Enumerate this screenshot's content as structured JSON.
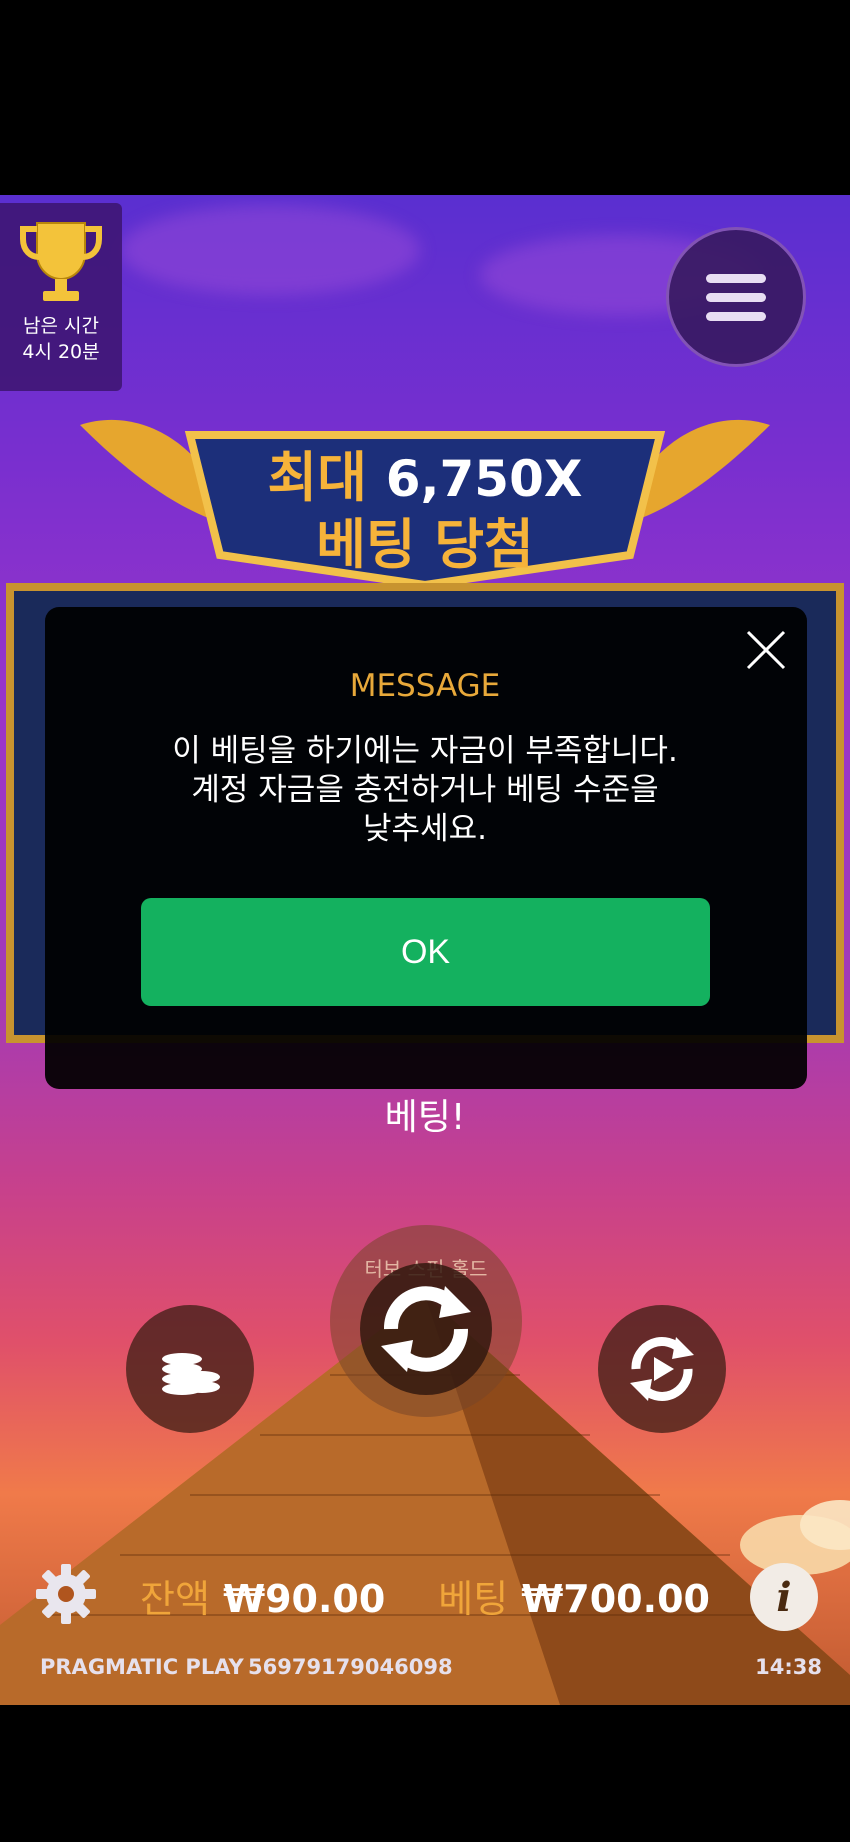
{
  "tournament": {
    "remaining_label": "남은 시간",
    "remaining_value": "4시 20분"
  },
  "banner": {
    "line1_prefix": "최대",
    "line1_value": "6,750X",
    "line2": "베팅 당첨"
  },
  "dialog": {
    "title": "MESSAGE",
    "body_lines": [
      "이 베팅을 하기에는 자금이 부족합니다.",
      "계정 자금을 충전하거나 베팅 수준을",
      "낮추세요."
    ],
    "ok_label": "OK"
  },
  "bet_prompt": "베팅!",
  "spin": {
    "turbo_hint": "터보 스핀 홀드"
  },
  "status": {
    "balance_label": "잔액",
    "balance_value": "₩90.00",
    "bet_label": "베팅",
    "bet_value": "₩700.00"
  },
  "footer": {
    "brand": "PRAGMATIC PLAY",
    "session_id": "56979179046098",
    "time": "14:38"
  },
  "icons": [
    "trophy-icon",
    "menu-icon",
    "close-icon",
    "coins-icon",
    "spin-icon",
    "autoplay-icon",
    "settings-icon",
    "info-icon"
  ],
  "colors": {
    "accent_gold": "#f0a53a",
    "ok_green": "#14b15f",
    "dialog_title": "#e8a93a"
  }
}
